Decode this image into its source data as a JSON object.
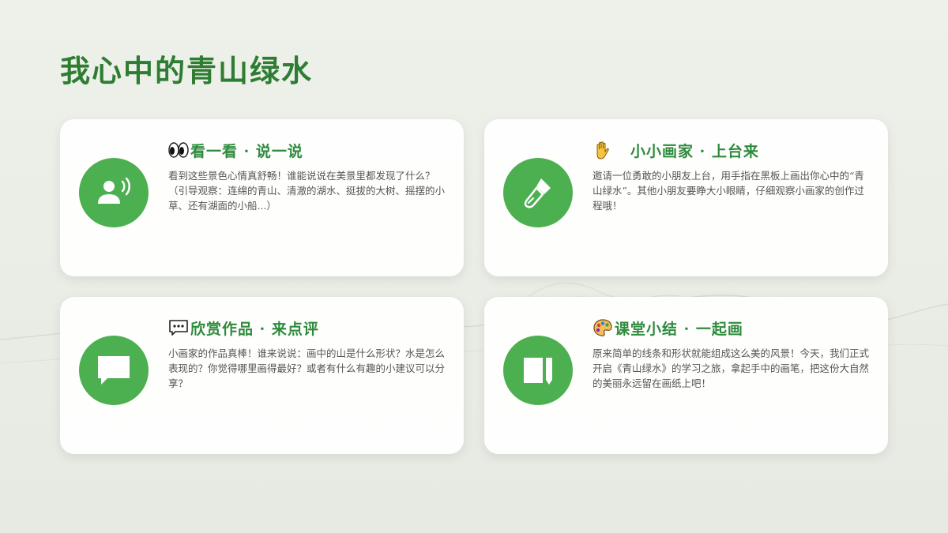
{
  "page": {
    "title": "我心中的青山绿水"
  },
  "colors": {
    "accent": "#4caf50",
    "title": "#2e7d32",
    "card_title": "#2e8b3d",
    "body_text": "#555555"
  },
  "cards": [
    {
      "icon": "speaking-person-icon",
      "emoji": "eyes-icon",
      "title": "看一看 · 说一说",
      "text": "看到这些景色心情真舒畅！谁能说说在美景里都发现了什么？（引导观察：连绵的青山、清澈的湖水、挺拔的大树、摇摆的小草、还有湖面的小船...）"
    },
    {
      "icon": "paint-brush-icon",
      "emoji": "raised-hand-icon",
      "title": "小小画家 · 上台来",
      "text": "邀请一位勇敢的小朋友上台，用手指在黑板上画出你心中的“青山绿水”。其他小朋友要睁大小眼睛，仔细观察小画家的创作过程哦！"
    },
    {
      "icon": "chat-bubble-icon",
      "emoji": "speech-balloon-icon",
      "title": "欣赏作品 · 来点评",
      "text": "小画家的作品真棒！谁来说说：画中的山是什么形状？水是怎么表现的？你觉得哪里画得最好？或者有什么有趣的小建议可以分享？"
    },
    {
      "icon": "notebook-pencil-icon",
      "emoji": "artist-palette-icon",
      "title": "课堂小结 · 一起画",
      "text": "原来简单的线条和形状就能组成这么美的风景！今天，我们正式开启《青山绿水》的学习之旅，拿起手中的画笔，把这份大自然的美丽永远留在画纸上吧！"
    }
  ]
}
